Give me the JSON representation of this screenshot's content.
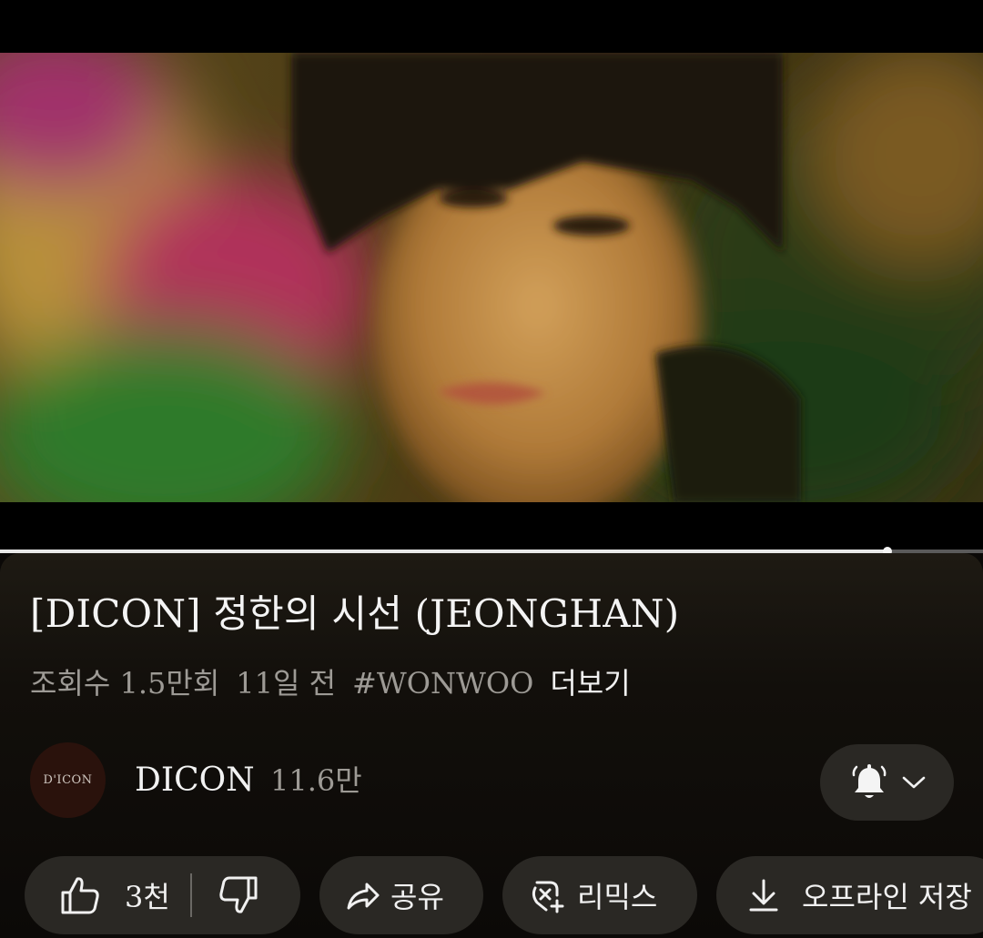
{
  "video": {
    "title": "[DICON] 정한의 시선 (JEONGHAN)",
    "progress_fraction": 0.903
  },
  "meta": {
    "views": "조회수 1.5만회",
    "age": "11일 전",
    "hashtag": "#WONWOO",
    "more": "더보기"
  },
  "channel": {
    "avatar_text": "D'ICON",
    "name": "DICON",
    "subscribers": "11.6만"
  },
  "subscribe_button": {
    "icons": [
      "bell-icon",
      "chevron-down-icon"
    ]
  },
  "actions": {
    "like_count": "3천",
    "share": "공유",
    "remix": "리믹스",
    "offline": "오프라인 저장"
  },
  "colors": {
    "background": "#0b0907",
    "chip_background": "#2a2824",
    "secondary_text": "#9d9a95",
    "progress_fill": "#e8e8e8"
  }
}
